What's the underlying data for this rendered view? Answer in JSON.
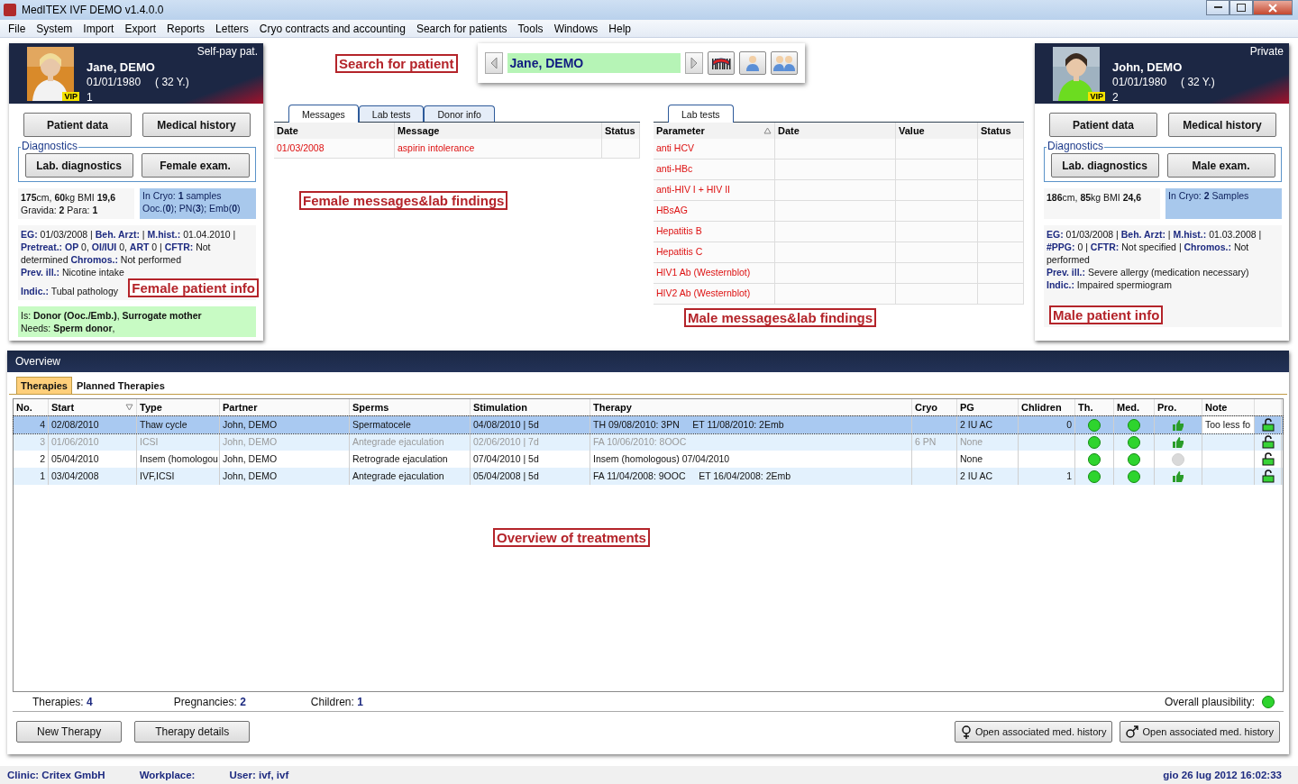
{
  "window": {
    "title": "MedITEX IVF DEMO v1.4.0.0"
  },
  "menu": [
    "File",
    "System",
    "Import",
    "Export",
    "Reports",
    "Letters",
    "Cryo contracts and accounting",
    "Search for patients",
    "Tools",
    "Windows",
    "Help"
  ],
  "female": {
    "insurance": "Self-pay pat.",
    "name": "Jane, DEMO",
    "dob": "01/01/1980",
    "age": "( 32 Y.)",
    "number": "1",
    "vip": "VIP",
    "buttons": [
      "Patient data",
      "Medical history"
    ],
    "diagnostics_label": "Diagnostics",
    "diagnostics_buttons": [
      "Lab. diagnostics",
      "Female exam."
    ],
    "body": [
      "**175**cm, **60**kg BMI **19,6**",
      "Gravida: **2** Para: **1**"
    ],
    "cryo": [
      "In Cryo: **1** samples",
      "Ooc.(**0**); PN(**3**); Emb(**0**)"
    ],
    "history": [
      "**EG:** 01/03/2008 | **Beh. Arzt:**  | **M.hist.:** 01.04.2010 |  **Pretreat.:**  **OP**  0,  **OI/IUI** 0,  **ART** 0  |  **CFTR:** Not determined **Chromos.:** Not performed",
      "**Prev. ill.:** Nicotine intake",
      "**Indic.:** Tubal pathology"
    ],
    "roles": [
      "Is: **Donor (Ooc./Emb.)**, **Surrogate mother**",
      "Needs: **Sperm donor**,"
    ],
    "callout": "Female patient info"
  },
  "search": {
    "callout": "Search for patient",
    "value": "Jane, DEMO"
  },
  "female_findings": {
    "tabs": [
      {
        "label": "Messages",
        "selected": true
      },
      {
        "label": "Lab tests",
        "selected": false
      },
      {
        "label": "Donor info",
        "selected": false
      }
    ],
    "columns": [
      "Date",
      "Message",
      "Status"
    ],
    "rows": [
      {
        "date": "01/03/2008",
        "message": "aspirin intolerance"
      }
    ],
    "callout": "Female messages&lab findings"
  },
  "male_findings": {
    "tabs": [
      {
        "label": "Lab tests",
        "selected": true
      }
    ],
    "columns": [
      "Parameter",
      "Date",
      "Value",
      "Status"
    ],
    "rows": [
      "anti HCV",
      "anti-HBc",
      "anti-HIV I + HIV II",
      "HBsAG",
      "Hepatitis B",
      "Hepatitis C",
      "HIV1 Ab (Westernblot)",
      "HIV2 Ab (Westernblot)"
    ],
    "callout": "Male messages&lab findings"
  },
  "male": {
    "insurance": "Private",
    "name": "John, DEMO",
    "dob": "01/01/1980",
    "age": "( 32 Y.)",
    "number": "2",
    "vip": "VIP",
    "buttons": [
      "Patient data",
      "Medical history"
    ],
    "diagnostics_label": "Diagnostics",
    "diagnostics_buttons": [
      "Lab. diagnostics",
      "Male exam."
    ],
    "body": [
      "**186**cm, **85**kg BMI **24,6**"
    ],
    "cryo": [
      "In Cryo: **2** Samples"
    ],
    "history": [
      "**EG:** 01/03/2008 | **Beh. Arzt:**  | **M.hist.:** 01.03.2008 |  **#PPG:** 0  |  **CFTR:** Not specified  |  **Chromos.:** Not performed",
      "**Prev. ill.:** Severe allergy (medication necessary)",
      "**Indic.:** Impaired spermiogram"
    ],
    "callout": "Male patient info"
  },
  "overview": {
    "title": "Overview",
    "tabs": [
      {
        "label": "Therapies",
        "selected": true
      },
      {
        "label": "Planned Therapies",
        "selected": false
      }
    ],
    "columns": [
      "No.",
      "Start",
      "Type",
      "Partner",
      "Sperms",
      "Stimulation",
      "Therapy",
      "Cryo",
      "PG",
      "Chlidren",
      "Th.",
      "Med.",
      "Pro.",
      "Note"
    ],
    "rows": [
      {
        "no": "4",
        "start": "02/08/2010",
        "type": "Thaw cycle",
        "partner": "John, DEMO",
        "sperms": "Spermatocele",
        "stimulation": "04/08/2010 | 5d",
        "therapy": "TH 09/08/2010: 3PN     ET 11/08/2010: 2Emb",
        "pg": "2 IU AC",
        "children": "0",
        "note": "Too less fo",
        "selected": true,
        "disabled": false,
        "th_ok": true,
        "med_ok": true,
        "pro_ok": true
      },
      {
        "no": "3",
        "start": "01/06/2010",
        "type": "ICSI",
        "partner": "John, DEMO",
        "sperms": "Antegrade ejaculation",
        "stimulation": "02/06/2010 | 7d",
        "therapy": "FA 10/06/2010: 8OOC",
        "cryo": "6 PN",
        "pg": "None",
        "selected": false,
        "disabled": true,
        "th_ok": true,
        "med_ok": true,
        "pro_ok": true
      },
      {
        "no": "2",
        "start": "05/04/2010",
        "type": "Insem (homologou",
        "partner": "John, DEMO",
        "sperms": "Retrograde ejaculation",
        "stimulation": "07/04/2010 | 5d",
        "therapy": "Insem (homologous) 07/04/2010",
        "pg": "None",
        "selected": false,
        "disabled": false,
        "th_ok": true,
        "med_ok": true,
        "pro_ok": false
      },
      {
        "no": "1",
        "start": "03/04/2008",
        "type": "IVF,ICSI",
        "partner": "John, DEMO",
        "sperms": "Antegrade ejaculation",
        "stimulation": "05/04/2008 | 5d",
        "therapy": "FA 11/04/2008: 9OOC     ET 16/04/2008: 2Emb",
        "pg": "2 IU AC",
        "children": "1",
        "selected": false,
        "disabled": false,
        "th_ok": true,
        "med_ok": true,
        "pro_ok": true
      }
    ],
    "callout": "Overview of treatments",
    "summary": [
      {
        "label": "Therapies:",
        "value": "4"
      },
      {
        "label": "Pregnancies:",
        "value": "2"
      },
      {
        "label": "Children:",
        "value": "1"
      }
    ],
    "plausibility_label": "Overall plausibility:",
    "buttons": [
      "New Therapy",
      "Therapy details"
    ],
    "history_buttons": [
      {
        "kind": "female",
        "label": "Open associated med. history"
      },
      {
        "kind": "male",
        "label": "Open associated med. history"
      }
    ]
  },
  "status_bar": {
    "clinic": "Clinic: Critex GmbH",
    "workplace": "Workplace:",
    "user": "User: ivf, ivf",
    "datetime": "gio 26 lug 2012 16:02:33"
  }
}
